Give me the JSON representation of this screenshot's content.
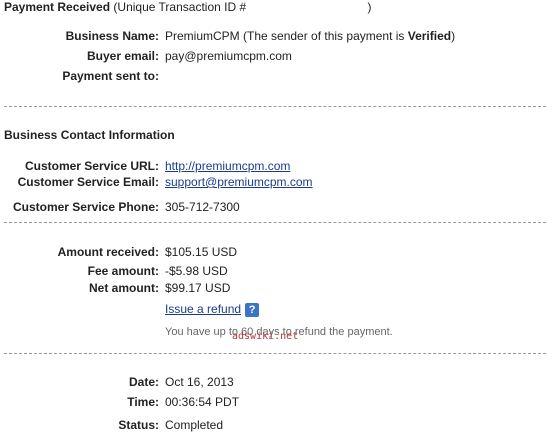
{
  "header": {
    "title": "Payment Received",
    "transaction_label": "(Unique Transaction ID #",
    "transaction_close": ")"
  },
  "business": {
    "name_label": "Business Name:",
    "name_value": "PremiumCPM",
    "sender_note_pre": " (The sender of this payment is ",
    "sender_note_bold": "Verified",
    "sender_note_post": ")",
    "email_label": "Buyer email:",
    "email_value": "pay@premiumcpm.com",
    "sent_to_label": "Payment sent to:",
    "sent_to_value": ""
  },
  "contact": {
    "section_title": "Business Contact Information",
    "url_label": "Customer Service URL:",
    "url_value": "http://premiumcpm.com",
    "email_label": "Customer Service Email:",
    "email_value": "support@premiumcpm.com",
    "phone_label": "Customer Service Phone:",
    "phone_value": "305-712-7300"
  },
  "amounts": {
    "received_label": "Amount received:",
    "received_value": "$105.15 USD",
    "fee_label": "Fee amount:",
    "fee_value": "-$5.98 USD",
    "net_label": "Net amount:",
    "net_value": "$99.17 USD",
    "refund_link": "Issue a refund",
    "help_icon": "?",
    "refund_note": "You have up to 60 days to refund the payment."
  },
  "details": {
    "date_label": "Date:",
    "date_value": "Oct 16, 2013",
    "time_label": "Time:",
    "time_value": "00:36:54 PDT",
    "status_label": "Status:",
    "status_value": "Completed"
  },
  "watermark": "adswiki.net"
}
